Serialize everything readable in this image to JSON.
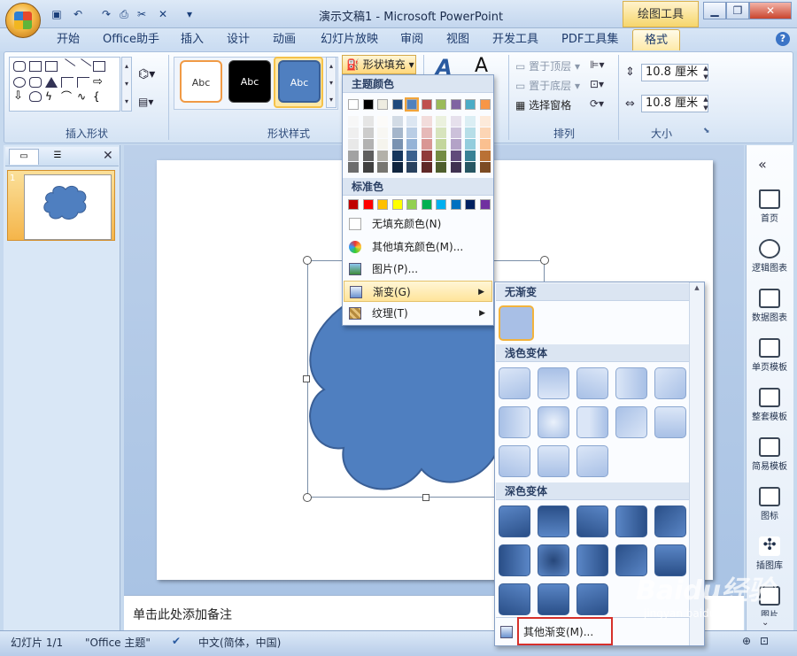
{
  "titlebar": {
    "title": "演示文稿1 - Microsoft PowerPoint",
    "context_tool": "绘图工具",
    "quick_access": [
      "save-icon",
      "undo-icon",
      "redo-icon",
      "print-preview-icon",
      "cut-icon",
      "delete-icon",
      "customize-icon"
    ]
  },
  "tabs": [
    "开始",
    "Office助手",
    "插入",
    "设计",
    "动画",
    "幻灯片放映",
    "审阅",
    "视图",
    "开发工具",
    "PDF工具集",
    "格式"
  ],
  "ribbon": {
    "groups": {
      "insert_shapes": "插入形状",
      "shape_styles": "形状样式",
      "arrange": "排列",
      "size": "大小"
    },
    "style_thumb_text": "Abc",
    "shape_fill_label": "形状填充",
    "arrange_items": [
      "置于顶层",
      "置于底层",
      "选择窗格"
    ],
    "size_height": "10.8 厘米",
    "size_width": "10.8 厘米"
  },
  "left_panel": {
    "slide_number": "1"
  },
  "fill_menu": {
    "theme_colors_label": "主题颜色",
    "standard_colors_label": "标准色",
    "no_fill": "无填充颜色(N)",
    "more_fill": "其他填充颜色(M)...",
    "picture": "图片(P)...",
    "gradient": "渐变(G)",
    "texture": "纹理(T)",
    "theme_top_row": [
      "#ffffff",
      "#000000",
      "#eeece1",
      "#1f497d",
      "#4f81bd",
      "#c0504d",
      "#9bbb59",
      "#8064a2",
      "#4bacc6",
      "#f79646"
    ],
    "standard_colors": [
      "#c00000",
      "#ff0000",
      "#ffc000",
      "#ffff00",
      "#92d050",
      "#00b050",
      "#00b0f0",
      "#0070c0",
      "#002060",
      "#7030a0"
    ]
  },
  "gradient_menu": {
    "none_label": "无渐变",
    "light_label": "浅色变体",
    "dark_label": "深色变体",
    "more_label": "其他渐变(M)..."
  },
  "notes": {
    "placeholder": "单击此处添加备注"
  },
  "right_panel": {
    "items": [
      "首页",
      "逻辑图表",
      "数据图表",
      "单页模板",
      "整套模板",
      "简易模板",
      "图标",
      "插图库",
      "图片"
    ]
  },
  "statusbar": {
    "slide": "幻灯片 1/1",
    "theme": "\"Office 主题\"",
    "language": "中文(简体，中国)"
  },
  "watermark": {
    "text": "Baidu经验",
    "sub": "jingyan.baidu.com"
  }
}
